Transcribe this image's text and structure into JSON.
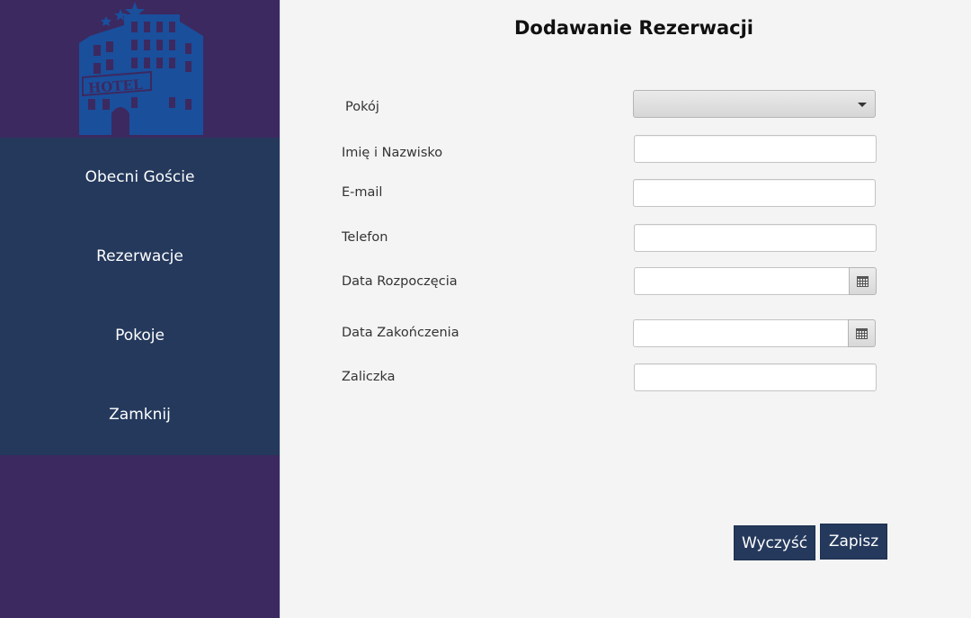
{
  "sidebar": {
    "logo_text": "HOTEL",
    "items": [
      {
        "label": "Obecni Goście"
      },
      {
        "label": "Rezerwacje"
      },
      {
        "label": "Pokoje"
      },
      {
        "label": "Zamknij"
      }
    ]
  },
  "form": {
    "title": "Dodawanie Rezerwacji",
    "room_label": "Pokój",
    "room_value": "",
    "name_label": "Imię i Nazwisko",
    "name_value": "",
    "email_label": "E-mail",
    "email_value": "",
    "phone_label": "Telefon",
    "phone_value": "",
    "start_label": "Data Rozpoczęcia",
    "start_value": "",
    "end_label": "Data Zakończenia",
    "end_value": "",
    "deposit_label": "Zaliczka",
    "deposit_value": ""
  },
  "actions": {
    "clear_label": "Wyczyść",
    "save_label": "Zapisz"
  },
  "colors": {
    "sidebar_bg": "#3c2960",
    "nav_bg": "#24395c",
    "logo": "#1a4f9c",
    "button_bg": "#24395c"
  },
  "icons": {
    "logo": "hotel-building-icon",
    "date_picker": "calendar-icon",
    "dropdown": "chevron-down-icon"
  }
}
